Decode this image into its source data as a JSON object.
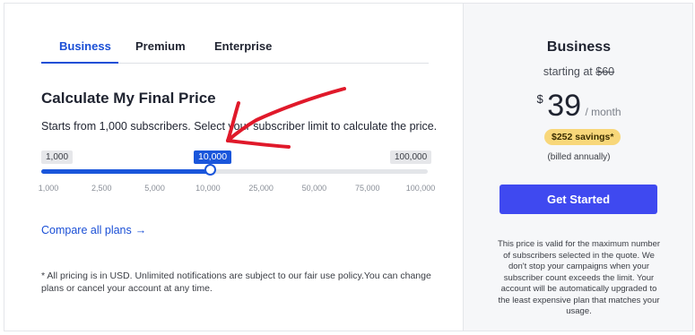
{
  "tabs": [
    {
      "label": "Business",
      "active": true
    },
    {
      "label": "Premium",
      "active": false
    },
    {
      "label": "Enterprise",
      "active": false
    }
  ],
  "calculator": {
    "title": "Calculate My Final Price",
    "description": "Starts from 1,000 subscribers. Select your subscriber limit to calculate the price.",
    "min_label": "1,000",
    "max_label": "100,000",
    "current_label": "10,000",
    "slider_value_fraction": 0.437,
    "ticks": [
      "1,000",
      "2,500",
      "5,000",
      "10,000",
      "25,000",
      "50,000",
      "75,000",
      "100,000"
    ]
  },
  "compare": {
    "label": "Compare all plans",
    "arrow": "→"
  },
  "footnote": "* All pricing is in USD. Unlimited notifications are subject to our fair use policy.You can change plans or cancel your account at any time.",
  "summary": {
    "plan_name": "Business",
    "starting_prefix": "starting at",
    "starting_old_price": "$60",
    "currency": "$",
    "amount": "39",
    "per": "/ month",
    "savings": "$252 savings*",
    "billed": "(billed annually)",
    "cta_label": "Get Started",
    "note": "This price is valid for the maximum number of subscribers selected in the quote. We don't stop your campaigns when your subscriber count exceeds the limit. Your account will be automatically upgraded to the least expensive plan that matches your usage."
  },
  "colors": {
    "accent": "#1a56db",
    "cta": "#3f49f0",
    "savings_badge": "#f8d77a",
    "annotation_arrow": "#e0192a"
  }
}
